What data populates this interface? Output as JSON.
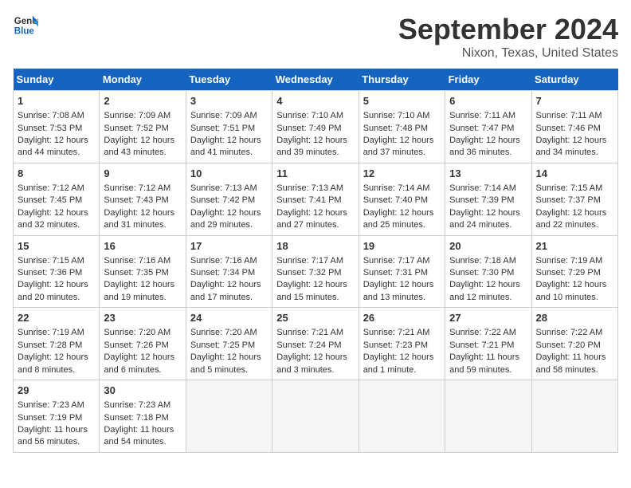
{
  "header": {
    "logo_line1": "General",
    "logo_line2": "Blue",
    "month": "September 2024",
    "location": "Nixon, Texas, United States"
  },
  "days_of_week": [
    "Sunday",
    "Monday",
    "Tuesday",
    "Wednesday",
    "Thursday",
    "Friday",
    "Saturday"
  ],
  "weeks": [
    [
      {
        "day": "1",
        "lines": [
          "Sunrise: 7:08 AM",
          "Sunset: 7:53 PM",
          "Daylight: 12 hours",
          "and 44 minutes."
        ]
      },
      {
        "day": "2",
        "lines": [
          "Sunrise: 7:09 AM",
          "Sunset: 7:52 PM",
          "Daylight: 12 hours",
          "and 43 minutes."
        ]
      },
      {
        "day": "3",
        "lines": [
          "Sunrise: 7:09 AM",
          "Sunset: 7:51 PM",
          "Daylight: 12 hours",
          "and 41 minutes."
        ]
      },
      {
        "day": "4",
        "lines": [
          "Sunrise: 7:10 AM",
          "Sunset: 7:49 PM",
          "Daylight: 12 hours",
          "and 39 minutes."
        ]
      },
      {
        "day": "5",
        "lines": [
          "Sunrise: 7:10 AM",
          "Sunset: 7:48 PM",
          "Daylight: 12 hours",
          "and 37 minutes."
        ]
      },
      {
        "day": "6",
        "lines": [
          "Sunrise: 7:11 AM",
          "Sunset: 7:47 PM",
          "Daylight: 12 hours",
          "and 36 minutes."
        ]
      },
      {
        "day": "7",
        "lines": [
          "Sunrise: 7:11 AM",
          "Sunset: 7:46 PM",
          "Daylight: 12 hours",
          "and 34 minutes."
        ]
      }
    ],
    [
      {
        "day": "8",
        "lines": [
          "Sunrise: 7:12 AM",
          "Sunset: 7:45 PM",
          "Daylight: 12 hours",
          "and 32 minutes."
        ]
      },
      {
        "day": "9",
        "lines": [
          "Sunrise: 7:12 AM",
          "Sunset: 7:43 PM",
          "Daylight: 12 hours",
          "and 31 minutes."
        ]
      },
      {
        "day": "10",
        "lines": [
          "Sunrise: 7:13 AM",
          "Sunset: 7:42 PM",
          "Daylight: 12 hours",
          "and 29 minutes."
        ]
      },
      {
        "day": "11",
        "lines": [
          "Sunrise: 7:13 AM",
          "Sunset: 7:41 PM",
          "Daylight: 12 hours",
          "and 27 minutes."
        ]
      },
      {
        "day": "12",
        "lines": [
          "Sunrise: 7:14 AM",
          "Sunset: 7:40 PM",
          "Daylight: 12 hours",
          "and 25 minutes."
        ]
      },
      {
        "day": "13",
        "lines": [
          "Sunrise: 7:14 AM",
          "Sunset: 7:39 PM",
          "Daylight: 12 hours",
          "and 24 minutes."
        ]
      },
      {
        "day": "14",
        "lines": [
          "Sunrise: 7:15 AM",
          "Sunset: 7:37 PM",
          "Daylight: 12 hours",
          "and 22 minutes."
        ]
      }
    ],
    [
      {
        "day": "15",
        "lines": [
          "Sunrise: 7:15 AM",
          "Sunset: 7:36 PM",
          "Daylight: 12 hours",
          "and 20 minutes."
        ]
      },
      {
        "day": "16",
        "lines": [
          "Sunrise: 7:16 AM",
          "Sunset: 7:35 PM",
          "Daylight: 12 hours",
          "and 19 minutes."
        ]
      },
      {
        "day": "17",
        "lines": [
          "Sunrise: 7:16 AM",
          "Sunset: 7:34 PM",
          "Daylight: 12 hours",
          "and 17 minutes."
        ]
      },
      {
        "day": "18",
        "lines": [
          "Sunrise: 7:17 AM",
          "Sunset: 7:32 PM",
          "Daylight: 12 hours",
          "and 15 minutes."
        ]
      },
      {
        "day": "19",
        "lines": [
          "Sunrise: 7:17 AM",
          "Sunset: 7:31 PM",
          "Daylight: 12 hours",
          "and 13 minutes."
        ]
      },
      {
        "day": "20",
        "lines": [
          "Sunrise: 7:18 AM",
          "Sunset: 7:30 PM",
          "Daylight: 12 hours",
          "and 12 minutes."
        ]
      },
      {
        "day": "21",
        "lines": [
          "Sunrise: 7:19 AM",
          "Sunset: 7:29 PM",
          "Daylight: 12 hours",
          "and 10 minutes."
        ]
      }
    ],
    [
      {
        "day": "22",
        "lines": [
          "Sunrise: 7:19 AM",
          "Sunset: 7:28 PM",
          "Daylight: 12 hours",
          "and 8 minutes."
        ]
      },
      {
        "day": "23",
        "lines": [
          "Sunrise: 7:20 AM",
          "Sunset: 7:26 PM",
          "Daylight: 12 hours",
          "and 6 minutes."
        ]
      },
      {
        "day": "24",
        "lines": [
          "Sunrise: 7:20 AM",
          "Sunset: 7:25 PM",
          "Daylight: 12 hours",
          "and 5 minutes."
        ]
      },
      {
        "day": "25",
        "lines": [
          "Sunrise: 7:21 AM",
          "Sunset: 7:24 PM",
          "Daylight: 12 hours",
          "and 3 minutes."
        ]
      },
      {
        "day": "26",
        "lines": [
          "Sunrise: 7:21 AM",
          "Sunset: 7:23 PM",
          "Daylight: 12 hours",
          "and 1 minute."
        ]
      },
      {
        "day": "27",
        "lines": [
          "Sunrise: 7:22 AM",
          "Sunset: 7:21 PM",
          "Daylight: 11 hours",
          "and 59 minutes."
        ]
      },
      {
        "day": "28",
        "lines": [
          "Sunrise: 7:22 AM",
          "Sunset: 7:20 PM",
          "Daylight: 11 hours",
          "and 58 minutes."
        ]
      }
    ],
    [
      {
        "day": "29",
        "lines": [
          "Sunrise: 7:23 AM",
          "Sunset: 7:19 PM",
          "Daylight: 11 hours",
          "and 56 minutes."
        ]
      },
      {
        "day": "30",
        "lines": [
          "Sunrise: 7:23 AM",
          "Sunset: 7:18 PM",
          "Daylight: 11 hours",
          "and 54 minutes."
        ]
      },
      null,
      null,
      null,
      null,
      null
    ]
  ]
}
